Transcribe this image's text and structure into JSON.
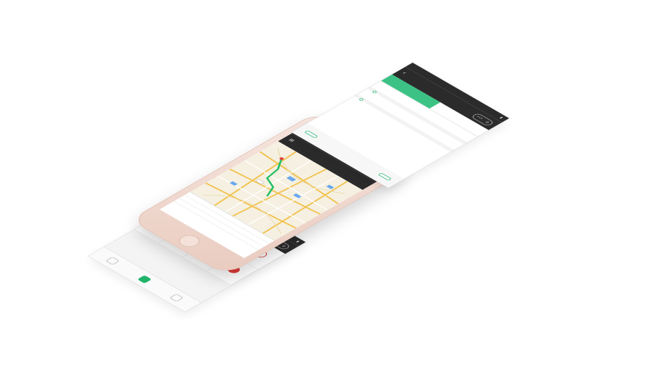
{
  "menu_screen": {
    "title": "",
    "status_text": "",
    "cells": [
      {
        "label": "",
        "icon": "clock-icon",
        "style": ""
      },
      {
        "label": "",
        "icon": "cup-icon",
        "style": ""
      },
      {
        "label": "",
        "icon": "basket-icon",
        "style": "green"
      },
      {
        "label": "",
        "icon": "box-icon",
        "style": ""
      },
      {
        "label": "",
        "icon": "alarm-icon",
        "style": ""
      },
      {
        "label": "",
        "icon": "cart-icon",
        "style": "green"
      },
      {
        "label": "",
        "icon": "document-icon",
        "style": "blue"
      },
      {
        "label": "",
        "icon": "record-icon",
        "style": "red-fill"
      }
    ]
  },
  "phone": {
    "nav_title": "",
    "map_label": "",
    "rows": [
      "",
      "",
      ""
    ]
  },
  "order_screen": {
    "title": "",
    "tabs": [
      "",
      ""
    ],
    "orders": [
      {
        "title": "",
        "status": "",
        "lines": [
          "",
          "",
          ""
        ]
      },
      {
        "title": "",
        "status": "",
        "lines": [
          "",
          "",
          ""
        ]
      }
    ],
    "footer_left": "",
    "footer_right": ""
  },
  "colors": {
    "accent_green": "#3cc285",
    "dark_bar": "#2b2b2b",
    "phone_rose": "#e9cbbf",
    "map_bg": "#f5f0e1"
  }
}
